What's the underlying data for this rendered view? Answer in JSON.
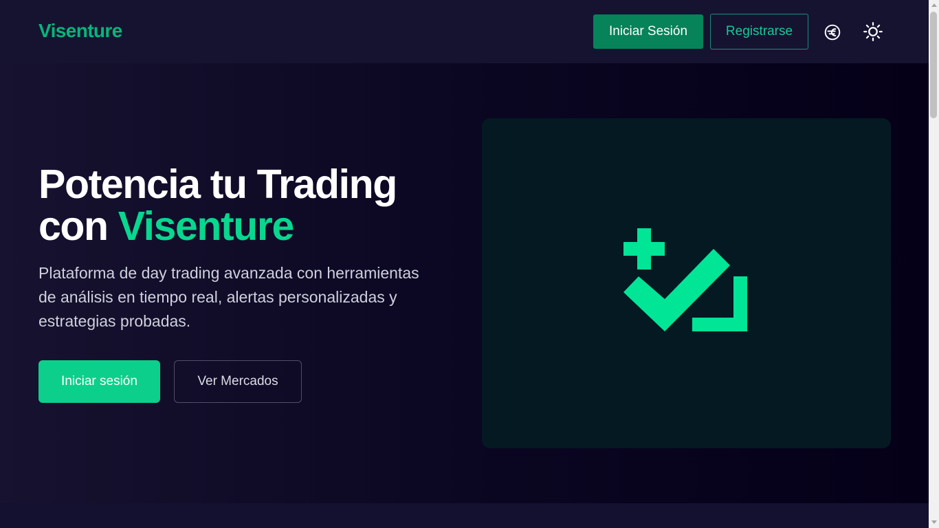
{
  "colors": {
    "brand": "#08b57a",
    "accent": "#08d78f",
    "primary_button": "#0ccf8b",
    "nav_button": "#068358",
    "background": "#121029",
    "card_background": "#041922"
  },
  "header": {
    "logo": "Visenture",
    "login_label": "Iniciar Sesión",
    "register_label": "Registrarse",
    "language_icon": "globe-icon",
    "theme_icon": "sun-icon"
  },
  "hero": {
    "title_line1": "Potencia tu Trading",
    "title_line2_prefix": "con",
    "title_line2_accent": "Visenture",
    "description": "Plataforma de day trading avanzada con herramientas de análisis en tiempo real, alertas personalizadas y estrategias probadas.",
    "login_button": "Iniciar sesión",
    "markets_button": "Ver Mercados",
    "illustration_icon": "checkmark-plus-icon"
  }
}
